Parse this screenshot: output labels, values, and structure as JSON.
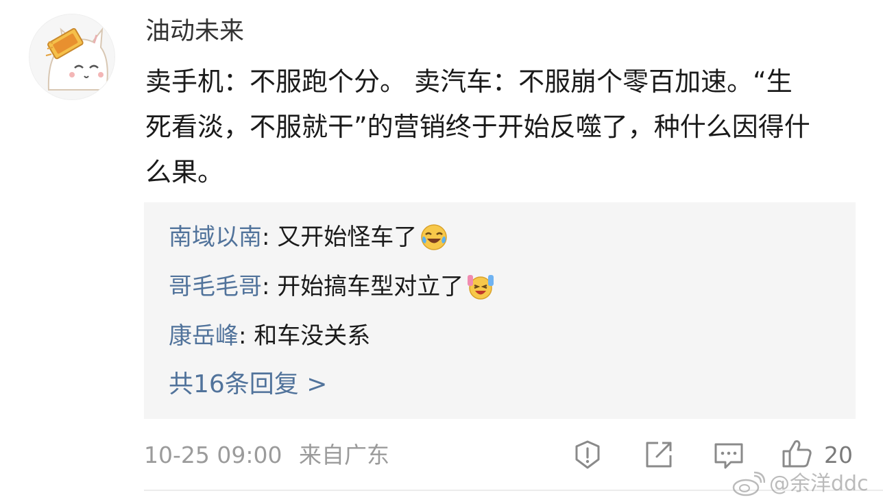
{
  "comment": {
    "username": "油动未来",
    "text": "卖手机：不服跑个分。 卖汽车：不服崩个零百加速。“生死看淡，不服就干”的营销终于开始反噬了，种什么因得什么果。",
    "replies": [
      {
        "name": "南域以南",
        "text": ": 又开始怪车了",
        "emoji": "laugh-cry-emoji"
      },
      {
        "name": "哥毛毛哥",
        "text": ": 开始搞车型对立了",
        "emoji": "hands-up-emoji"
      },
      {
        "name": "康岳峰",
        "text": ": 和车没关系",
        "emoji": ""
      }
    ],
    "more_replies": "共16条回复 >",
    "timestamp": "10-25 09:00",
    "location": "来自广东",
    "like_count": "20"
  },
  "watermark": "@余洋ddc",
  "colors": {
    "link": "#51739b",
    "text": "#1a1a1a",
    "meta": "#9b9b9b",
    "reply_bg": "#f5f5f5"
  }
}
